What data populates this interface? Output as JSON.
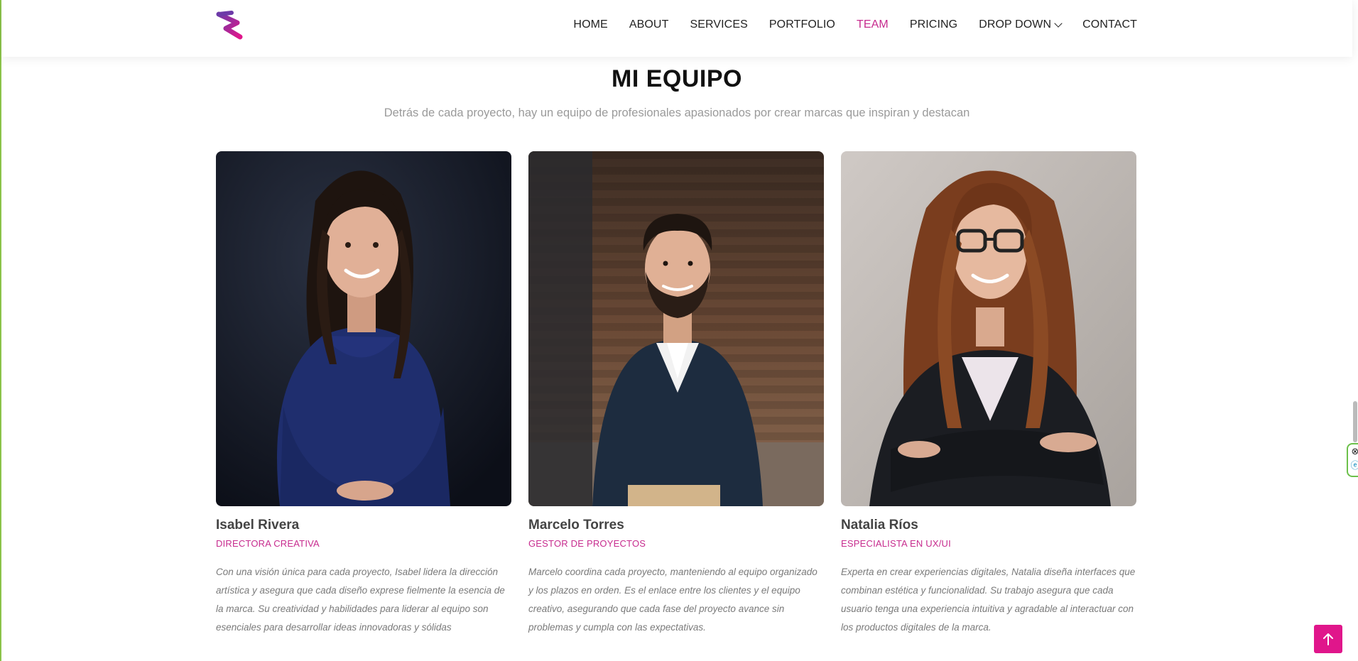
{
  "header": {
    "logo_icon": "brand-s-logo",
    "nav": [
      {
        "label": "HOME",
        "active": false
      },
      {
        "label": "ABOUT",
        "active": false
      },
      {
        "label": "SERVICES",
        "active": false
      },
      {
        "label": "PORTFOLIO",
        "active": false
      },
      {
        "label": "TEAM",
        "active": true
      },
      {
        "label": "PRICING",
        "active": false
      },
      {
        "label": "DROP DOWN",
        "active": false,
        "icon": "chevron-down-icon"
      },
      {
        "label": "CONTACT",
        "active": false
      }
    ]
  },
  "section": {
    "title": "MI EQUIPO",
    "subtitle": "Detrás de cada proyecto, hay un equipo de profesionales apasionados por crear marcas que inspiran y destacan"
  },
  "team": [
    {
      "name": "Isabel Rivera",
      "role": "DIRECTORA CREATIVA",
      "bio": "Con una visión única para cada proyecto, Isabel lidera la dirección artística y asegura que cada diseño exprese fielmente la esencia de la marca. Su creatividad y habilidades para liderar al equipo son esenciales para desarrollar ideas innovadoras y sólidas"
    },
    {
      "name": "Marcelo Torres",
      "role": "GESTOR DE PROYECTOS",
      "bio": "Marcelo coordina cada proyecto, manteniendo al equipo organizado y los plazos en orden. Es el enlace entre los clientes y el equipo creativo, asegurando que cada fase del proyecto avance sin problemas y cumpla con las expectativas."
    },
    {
      "name": "Natalia Ríos",
      "role": "ESPECIALISTA EN UX/UI",
      "bio": "Experta en crear experiencias digitales, Natalia diseña interfaces que combinan estética y funcionalidad. Su trabajo asegura que cada usuario tenga una experiencia intuitiva y agradable al interactuar con los productos digitales de la marca."
    }
  ],
  "colors": {
    "accent": "#c72b8e",
    "back_to_top": "#e0168b",
    "title": "#111111",
    "subtitle": "#9a9a9a"
  },
  "widgets": {
    "back_to_top_icon": "arrow-up-icon",
    "side_close_icon": "close-circle-icon",
    "side_e_icon": "e-circle-icon"
  }
}
